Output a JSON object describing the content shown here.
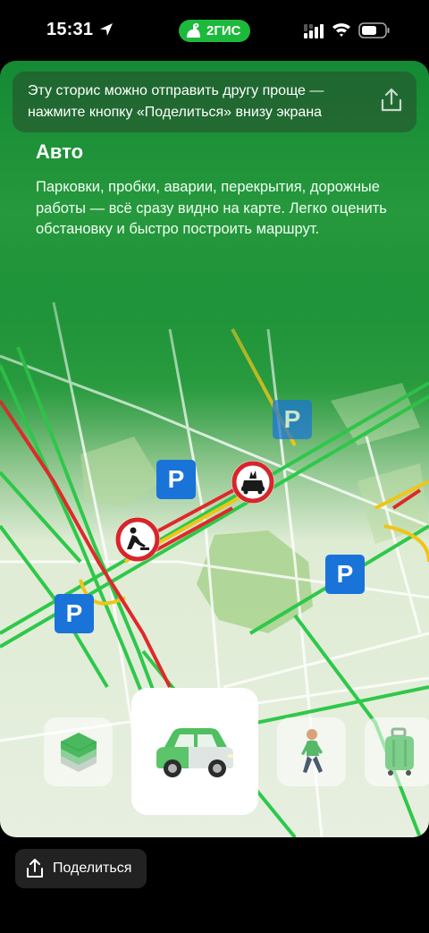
{
  "status_bar": {
    "time": "15:31",
    "brand_label": "2ГИС"
  },
  "tooltip": {
    "text": "Эту сторис можно отправить другу проще — нажмите кнопку «Поделиться» внизу экрана",
    "share_icon": "share-icon"
  },
  "story": {
    "title": "Авто",
    "description": "Парковки, пробки, аварии, перекрытия, дорожные работы — всё сразу видно на карте. Легко оценить обстановку и быстро построить маршрут."
  },
  "map": {
    "parking_label": "P",
    "signs": [
      "road-works-icon",
      "accident-icon"
    ]
  },
  "tiles": [
    {
      "name": "layers",
      "icon": "layers-icon",
      "active": false
    },
    {
      "name": "car",
      "icon": "car-icon",
      "active": true
    },
    {
      "name": "walk",
      "icon": "pedestrian-icon",
      "active": false
    },
    {
      "name": "travel",
      "icon": "suitcase-icon",
      "active": false
    }
  ],
  "bottom": {
    "share_label": "Поделиться"
  },
  "colors": {
    "brand_green": "#1db93c",
    "parking_blue": "#1a73d9",
    "jam_red": "#e0282a",
    "free_green": "#2ec84a",
    "slow_yellow": "#f0c419"
  }
}
